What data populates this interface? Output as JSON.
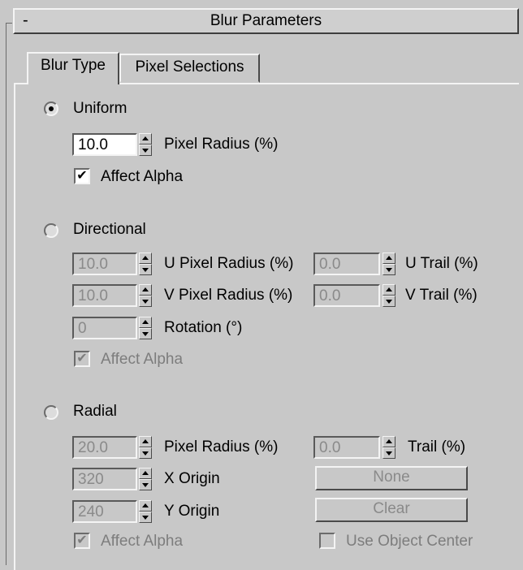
{
  "rollout": {
    "title": "Blur Parameters",
    "collapse_symbol": "-"
  },
  "tabs": [
    {
      "label": "Blur Type",
      "active": true
    },
    {
      "label": "Pixel Selections",
      "active": false
    }
  ],
  "uniform": {
    "label": "Uniform",
    "selected": true,
    "pixel_radius": {
      "value": "10.0",
      "label": "Pixel Radius (%)"
    },
    "affect_alpha": {
      "label": "Affect Alpha",
      "checked": true
    }
  },
  "directional": {
    "label": "Directional",
    "selected": false,
    "u_pixel_radius": {
      "value": "10.0",
      "label": "U Pixel Radius (%)"
    },
    "u_trail": {
      "value": "0.0",
      "label": "U Trail (%)"
    },
    "v_pixel_radius": {
      "value": "10.0",
      "label": "V Pixel Radius (%)"
    },
    "v_trail": {
      "value": "0.0",
      "label": "V Trail (%)"
    },
    "rotation": {
      "value": "0",
      "label": "Rotation (°)"
    },
    "affect_alpha": {
      "label": "Affect Alpha",
      "checked": true
    }
  },
  "radial": {
    "label": "Radial",
    "selected": false,
    "pixel_radius": {
      "value": "20.0",
      "label": "Pixel Radius (%)"
    },
    "trail": {
      "value": "0.0",
      "label": "Trail (%)"
    },
    "x_origin": {
      "value": "320",
      "label": "X Origin"
    },
    "y_origin": {
      "value": "240",
      "label": "Y Origin"
    },
    "none_button": "None",
    "clear_button": "Clear",
    "affect_alpha": {
      "label": "Affect Alpha",
      "checked": true
    },
    "use_object_center": {
      "label": "Use Object Center",
      "checked": false
    }
  },
  "icons": {
    "checkmark": "✔",
    "spinner": "spinner-arrows"
  },
  "colors": {
    "background": "#c8c8c8",
    "disabled_text": "#7d7d7d"
  }
}
